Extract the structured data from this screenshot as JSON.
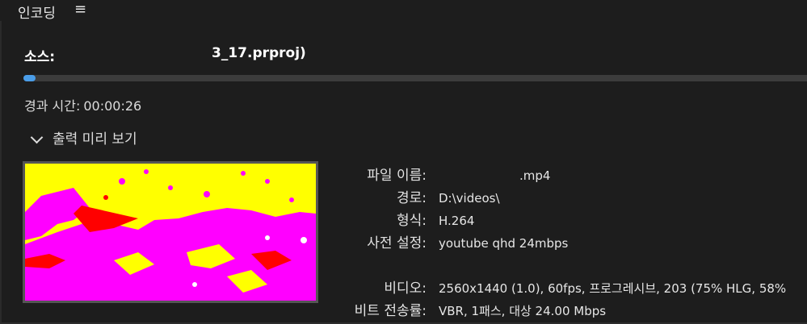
{
  "panel": {
    "title": "인코딩",
    "menu_icon": "hamburger-menu-icon"
  },
  "source": {
    "label": "소스:",
    "filename_suffix": "3_17.prproj)",
    "progress": 0.015
  },
  "elapsed": {
    "label": "경과 시간:",
    "value": "00:00:26"
  },
  "preview": {
    "header": "출력 미리 보기",
    "chevron_icon": "chevron-down-icon",
    "colors": {
      "yellow": "#ffff00",
      "magenta": "#ff00ff",
      "red": "#ff0000"
    }
  },
  "info": {
    "filename": {
      "label": "파일 이름:",
      "value": ".mp4"
    },
    "path": {
      "label": "경로:",
      "value": "D:\\videos\\"
    },
    "format": {
      "label": "형식:",
      "value": "H.264"
    },
    "preset": {
      "label": "사전 설정:",
      "value": "youtube qhd 24mbps"
    },
    "video": {
      "label": "비디오:",
      "value": "2560x1440 (1.0), 60fps, 프로그레시브, 203 (75% HLG, 58%"
    },
    "bitrate": {
      "label": "비트 전송률:",
      "value": "VBR, 1패스, 대상 24.00 Mbps"
    }
  }
}
